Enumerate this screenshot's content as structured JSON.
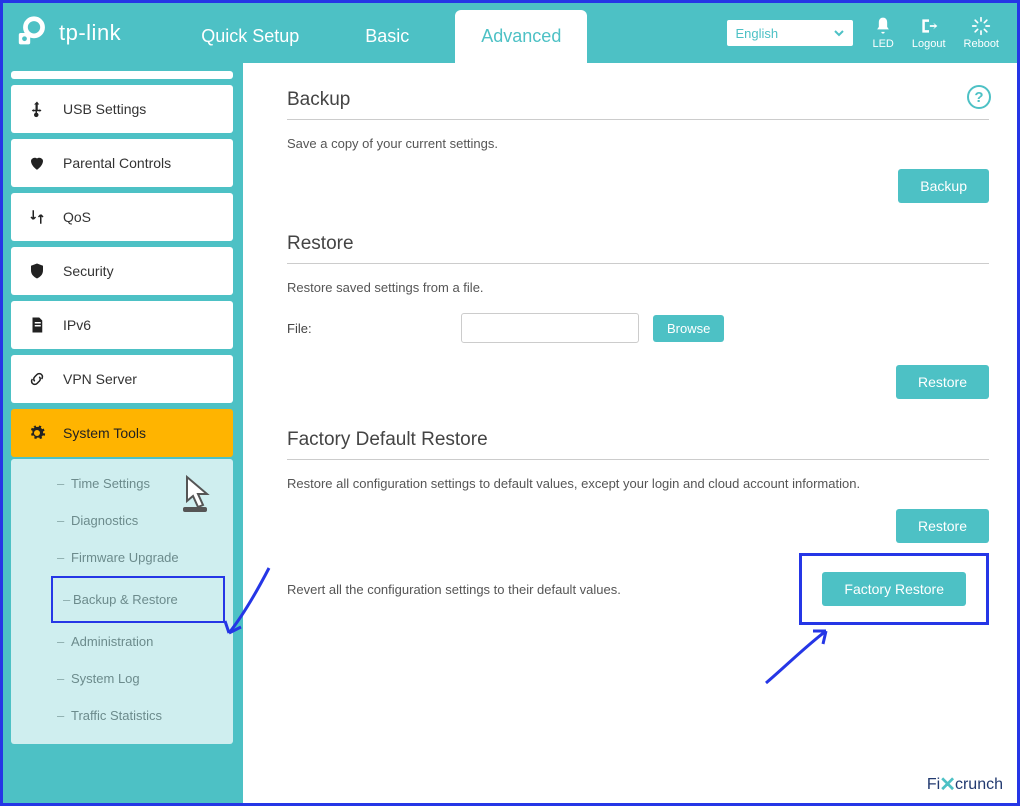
{
  "brand": "tp-link",
  "tabs": {
    "quick_setup": "Quick Setup",
    "basic": "Basic",
    "advanced": "Advanced"
  },
  "header": {
    "language": "English",
    "led": "LED",
    "logout": "Logout",
    "reboot": "Reboot"
  },
  "sidebar": {
    "usb": "USB Settings",
    "parental": "Parental Controls",
    "qos": "QoS",
    "security": "Security",
    "ipv6": "IPv6",
    "vpn": "VPN Server",
    "system_tools": "System Tools"
  },
  "submenu": {
    "time": "Time Settings",
    "diagnostics": "Diagnostics",
    "firmware": "Firmware Upgrade",
    "backup_restore": "Backup & Restore",
    "administration": "Administration",
    "system_log": "System Log",
    "traffic": "Traffic Statistics"
  },
  "backup": {
    "title": "Backup",
    "desc": "Save a copy of your current settings.",
    "button": "Backup"
  },
  "restore": {
    "title": "Restore",
    "desc": "Restore saved settings from a file.",
    "file_label": "File:",
    "browse": "Browse",
    "button": "Restore"
  },
  "factory": {
    "title": "Factory Default Restore",
    "desc1": "Restore all configuration settings to default values, except your login and cloud account information.",
    "restore_button": "Restore",
    "desc2": "Revert all the configuration settings to their default values.",
    "factory_button": "Factory Restore"
  },
  "help": "?",
  "watermark": {
    "a": "Fi",
    "b": "crunch"
  },
  "colors": {
    "primary": "#4dc1c5",
    "accent": "#ffb400",
    "annotation": "#2536e6"
  }
}
